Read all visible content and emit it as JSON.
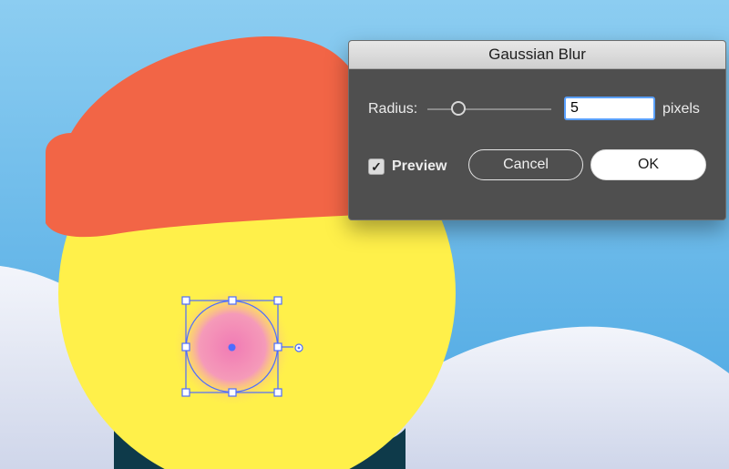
{
  "dialog": {
    "title": "Gaussian Blur",
    "radius_label": "Radius:",
    "radius_value": "5",
    "units_label": "pixels",
    "preview_label": "Preview",
    "preview_checked": true,
    "cancel_label": "Cancel",
    "ok_label": "OK",
    "slider_value": 5
  },
  "icons": {
    "checkbox_checkmark": "✓"
  },
  "colors": {
    "sky": "#5fb2e6",
    "hat": "#f26546",
    "face": "#fff04a",
    "blush": "#f28ab6",
    "selection": "#4d6cff",
    "dialog_bg": "#4f4f4f"
  }
}
